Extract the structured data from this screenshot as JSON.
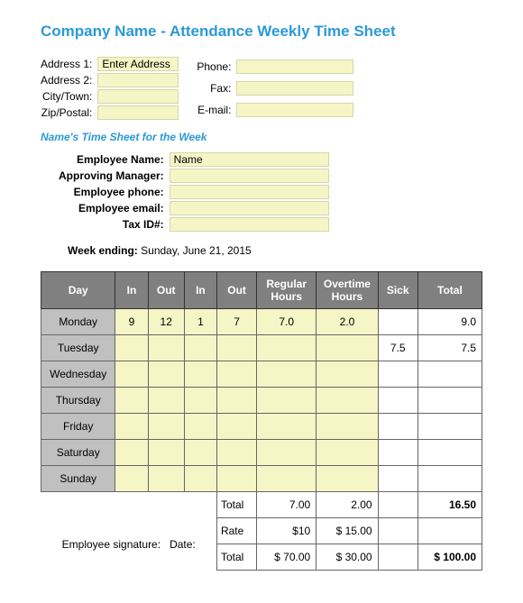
{
  "title": "Company Name - Attendance Weekly Time Sheet",
  "company": {
    "address1_label": "Address 1:",
    "address1_value": "Enter Address",
    "address2_label": "Address 2:",
    "address2_value": "",
    "city_label": "City/Town:",
    "city_value": "",
    "zip_label": "Zip/Postal:",
    "zip_value": "",
    "phone_label": "Phone:",
    "phone_value": "",
    "fax_label": "Fax:",
    "fax_value": "",
    "email_label": "E-mail:",
    "email_value": ""
  },
  "subheader": "Name's Time Sheet for the Week",
  "employee": {
    "name_label": "Employee Name:",
    "name_value": "Name",
    "manager_label": "Approving Manager:",
    "manager_value": "",
    "phone_label": "Employee phone:",
    "phone_value": "",
    "email_label": "Employee email:",
    "email_value": "",
    "tax_label": "Tax ID#:",
    "tax_value": ""
  },
  "week_ending_label": "Week ending:",
  "week_ending_value": "Sunday, June 21, 2015",
  "table": {
    "headers": {
      "day": "Day",
      "in1": "In",
      "out1": "Out",
      "in2": "In",
      "out2": "Out",
      "regular": "Regular Hours",
      "overtime": "Overtime Hours",
      "sick": "Sick",
      "total": "Total"
    },
    "rows": [
      {
        "day": "Monday",
        "in1": "9",
        "out1": "12",
        "in2": "1",
        "out2": "7",
        "regular": "7.0",
        "overtime": "2.0",
        "sick": "",
        "total": "9.0"
      },
      {
        "day": "Tuesday",
        "in1": "",
        "out1": "",
        "in2": "",
        "out2": "",
        "regular": "",
        "overtime": "",
        "sick": "7.5",
        "total": "7.5"
      },
      {
        "day": "Wednesday",
        "in1": "",
        "out1": "",
        "in2": "",
        "out2": "",
        "regular": "",
        "overtime": "",
        "sick": "",
        "total": ""
      },
      {
        "day": "Thursday",
        "in1": "",
        "out1": "",
        "in2": "",
        "out2": "",
        "regular": "",
        "overtime": "",
        "sick": "",
        "total": ""
      },
      {
        "day": "Friday",
        "in1": "",
        "out1": "",
        "in2": "",
        "out2": "",
        "regular": "",
        "overtime": "",
        "sick": "",
        "total": ""
      },
      {
        "day": "Saturday",
        "in1": "",
        "out1": "",
        "in2": "",
        "out2": "",
        "regular": "",
        "overtime": "",
        "sick": "",
        "total": ""
      },
      {
        "day": "Sunday",
        "in1": "",
        "out1": "",
        "in2": "",
        "out2": "",
        "regular": "",
        "overtime": "",
        "sick": "",
        "total": ""
      }
    ]
  },
  "summary": {
    "total_label": "Total",
    "total_regular": "7.00",
    "total_overtime": "2.00",
    "total_sick": "",
    "total_total": "16.50",
    "rate_label": "Rate",
    "rate_regular": "$10",
    "rate_overtime": "$   15.00",
    "grand_label": "Total",
    "grand_regular": "$  70.00",
    "grand_overtime": "$   30.00",
    "grand_total": "$  100.00"
  },
  "signature": {
    "emp_sig": "Employee signature:",
    "date": "Date:"
  },
  "chart_data": {
    "type": "table",
    "title": "Attendance Weekly Time Sheet",
    "columns": [
      "Day",
      "In",
      "Out",
      "In",
      "Out",
      "Regular Hours",
      "Overtime Hours",
      "Sick",
      "Total"
    ],
    "rows": [
      [
        "Monday",
        9,
        12,
        1,
        7,
        7.0,
        2.0,
        null,
        9.0
      ],
      [
        "Tuesday",
        null,
        null,
        null,
        null,
        null,
        null,
        7.5,
        7.5
      ],
      [
        "Wednesday",
        null,
        null,
        null,
        null,
        null,
        null,
        null,
        null
      ],
      [
        "Thursday",
        null,
        null,
        null,
        null,
        null,
        null,
        null,
        null
      ],
      [
        "Friday",
        null,
        null,
        null,
        null,
        null,
        null,
        null,
        null
      ],
      [
        "Saturday",
        null,
        null,
        null,
        null,
        null,
        null,
        null,
        null
      ],
      [
        "Sunday",
        null,
        null,
        null,
        null,
        null,
        null,
        null,
        null
      ]
    ],
    "totals": {
      "regular": 7.0,
      "overtime": 2.0,
      "grand": 16.5
    },
    "rates": {
      "regular": 10,
      "overtime": 15.0
    },
    "pay": {
      "regular": 70.0,
      "overtime": 30.0,
      "total": 100.0
    }
  }
}
